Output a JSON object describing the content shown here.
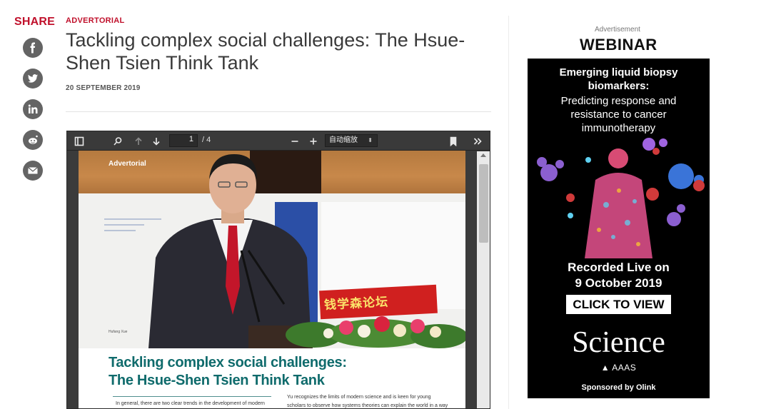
{
  "share": {
    "title": "SHARE",
    "buttons": [
      {
        "icon": "facebook-icon"
      },
      {
        "icon": "twitter-icon"
      },
      {
        "icon": "linkedin-icon"
      },
      {
        "icon": "reddit-icon"
      },
      {
        "icon": "email-icon"
      }
    ]
  },
  "article": {
    "kicker": "ADVERTORIAL",
    "headline": "Tackling complex social challenges: The Hsue-Shen Tsien Think Tank",
    "date": "20 SEPTEMBER 2019"
  },
  "pdf_viewer": {
    "page_current": "1",
    "page_total": "/ 4",
    "zoom_label": "自动缩放",
    "zoom_caret": "⬍",
    "page": {
      "advertorial_label": "Advertorial",
      "sign_text": "钱学森论坛",
      "caption": "Hufang Xue",
      "title_line1": "Tackling complex social challenges:",
      "title_line2": "The Hsue-Shen Tsien Think Tank",
      "col1_text": "In general, there are two clear trends in the development of modern",
      "col2_line1": "Yu recognizes the limits of modern science and is keen for young",
      "col2_line2": "scholars to observe how systems theories can explain the world in a way"
    }
  },
  "ad": {
    "label": "Advertisement",
    "heading": "WEBINAR",
    "lead": "Emerging liquid biopsy biomarkers:",
    "sub": "Predicting response and resistance to cancer immunotherapy",
    "recorded_line1": "Recorded Live on",
    "recorded_line2": "9 October 2019",
    "cta": "CLICK TO VIEW",
    "brand": "Science",
    "brand_sub": "AAAS",
    "sponsor": "Sponsored by Olink"
  },
  "colors": {
    "brand_red": "#c0102b",
    "share_icon_bg": "#646464",
    "viewer_bg": "#3a3a3a",
    "pdf_title_teal": "#0f6b6c",
    "ad_bg": "#000000"
  }
}
